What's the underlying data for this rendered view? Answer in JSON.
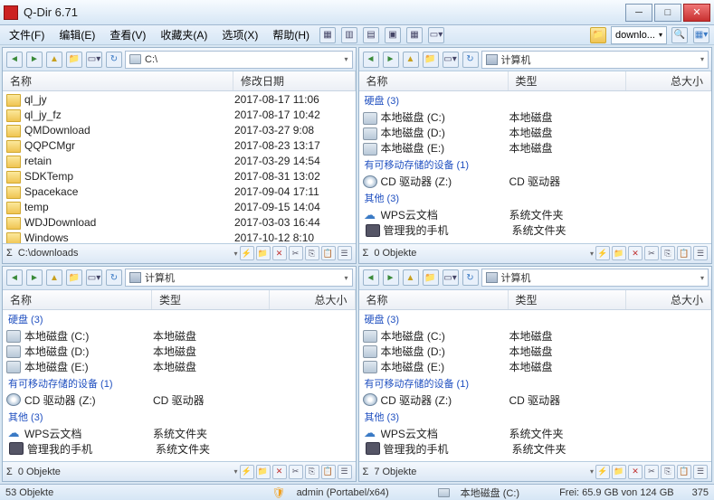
{
  "window": {
    "title": "Q-Dir 6.71"
  },
  "menu": {
    "file": "文件(F)",
    "edit": "编辑(E)",
    "view": "查看(V)",
    "fav": "收藏夹(A)",
    "opt": "选项(X)",
    "help": "帮助(H)",
    "download": "downlo..."
  },
  "cols": {
    "name": "名称",
    "moddate": "修改日期",
    "type": "类型",
    "size": "总大小"
  },
  "groups": {
    "disk": "硬盘 (3)",
    "removable": "有可移动存储的设备 (1)",
    "other": "其他 (3)"
  },
  "typestr": {
    "localdisk": "本地磁盘",
    "cddrive": "CD 驱动器",
    "sysfolder": "系统文件夹"
  },
  "drives": {
    "c": "本地磁盘 (C:)",
    "d": "本地磁盘 (D:)",
    "e": "本地磁盘 (E:)",
    "cd": "CD 驱动器 (Z:)",
    "wps": "WPS云文档",
    "phone": "管理我的手机"
  },
  "pane1": {
    "addr": "C:\\",
    "files": [
      {
        "n": "ql_jy",
        "d": "2017-08-17 11:06"
      },
      {
        "n": "ql_jy_fz",
        "d": "2017-08-17 10:42"
      },
      {
        "n": "QMDownload",
        "d": "2017-03-27 9:08"
      },
      {
        "n": "QQPCMgr",
        "d": "2017-08-23 13:17"
      },
      {
        "n": "retain",
        "d": "2017-03-29 14:54"
      },
      {
        "n": "SDKTemp",
        "d": "2017-08-31 13:02"
      },
      {
        "n": "Spacekace",
        "d": "2017-09-04 17:11"
      },
      {
        "n": "temp",
        "d": "2017-09-15 14:04"
      },
      {
        "n": "WDJDownload",
        "d": "2017-03-03 16:44"
      },
      {
        "n": "Windows",
        "d": "2017-10-12 8:10"
      }
    ],
    "status": "C:\\downloads"
  },
  "pane2": {
    "addr": "计算机",
    "status": "0 Objekte"
  },
  "pane3": {
    "addr": "计算机",
    "status": "0 Objekte"
  },
  "pane4": {
    "addr": "计算机",
    "status": "7 Objekte"
  },
  "status": {
    "objects": "53 Objekte",
    "admin": "admin (Portabel/x64)",
    "disklabel": "本地磁盘 (C:)",
    "free": "Frei: 65.9 GB von 124 GB",
    "num": "375"
  }
}
